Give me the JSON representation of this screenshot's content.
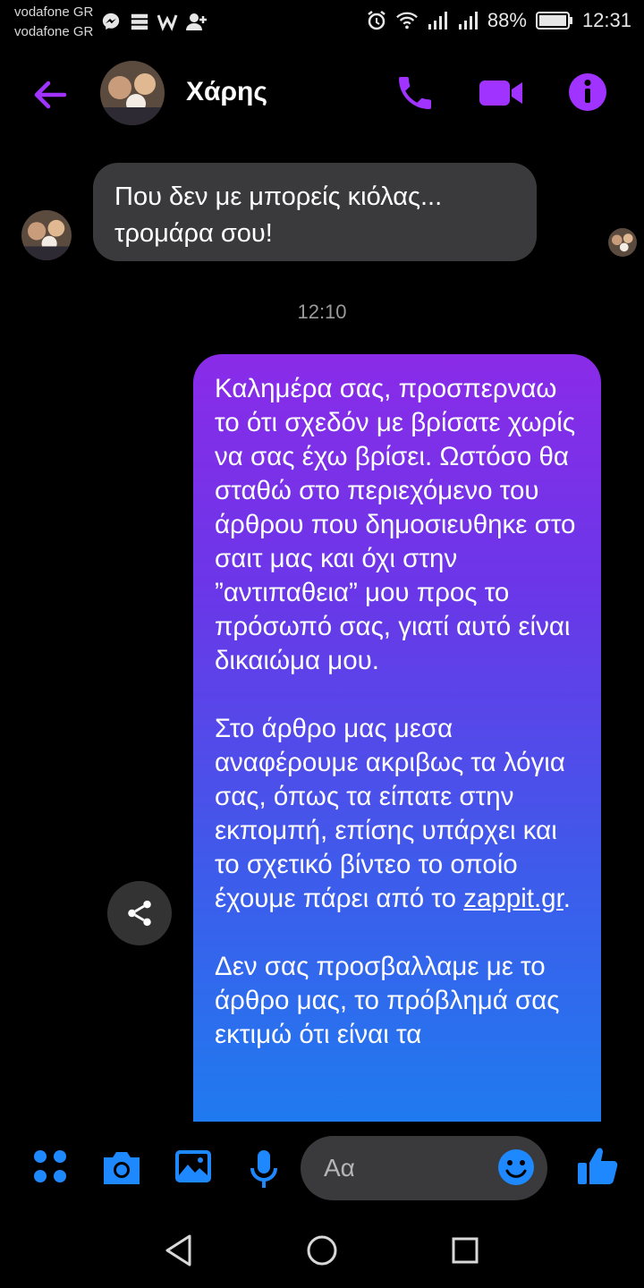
{
  "status_bar": {
    "carrier_1": "vodafone GR",
    "carrier_2": "vodafone GR",
    "battery": "88%",
    "time": "12:31",
    "icons": [
      "messenger-icon",
      "storage-icon",
      "w-app-icon",
      "add-contact-icon",
      "alarm-icon",
      "wifi-icon",
      "signal-icon",
      "signal-icon",
      "battery-icon"
    ]
  },
  "header": {
    "contact_name": "Χάρης",
    "icons": [
      "back-arrow-icon",
      "phone-icon",
      "video-camera-icon",
      "info-icon"
    ]
  },
  "chat": {
    "incoming_message": {
      "line_1": "Που δεν με μπορείς κιόλας...",
      "line_2": "τρομάρα σου!"
    },
    "timestamp": "12:10",
    "outgoing_message": {
      "paragraph_1": "Καλημέρα σας, προσπερναω το ότι σχεδόν με βρίσατε χωρίς να σας έχω βρίσει. Ωστόσο θα σταθώ στο περιεχόμενο του άρθρου που δημοσιευθηκε στο σαιτ μας και όχι στην ”αντιπαθεια” μου προς το πρόσωπό σας, γιατί αυτό είναι δικαιώμα μου.",
      "paragraph_2_start": "Στο άρθρο μας μεσα αναφέρουμε ακριβως τα λόγια σας, όπως τα είπατε στην εκπομπή, επίσης υπάρχει και το σχετικό βίντεο το οποίο έχουμε πάρει από το ",
      "paragraph_2_link": "zappit.gr",
      "paragraph_2_end": ".",
      "paragraph_3": "Δεν σας προσβαλλαμε με το άρθρο μας, το πρόβλημά σας εκτιμώ ότι είναι τα"
    }
  },
  "composer": {
    "placeholder": "Αα",
    "icons": [
      "menu-dots-icon",
      "camera-icon",
      "gallery-icon",
      "microphone-icon",
      "emoji-icon",
      "thumbs-up-icon"
    ]
  },
  "colors": {
    "accent": "#a033ff",
    "blue": "#1e88ff",
    "bubble_top": "#8a2be8",
    "bubble_bottom": "#1b7ff0",
    "incoming_bg": "#3a3a3c"
  }
}
